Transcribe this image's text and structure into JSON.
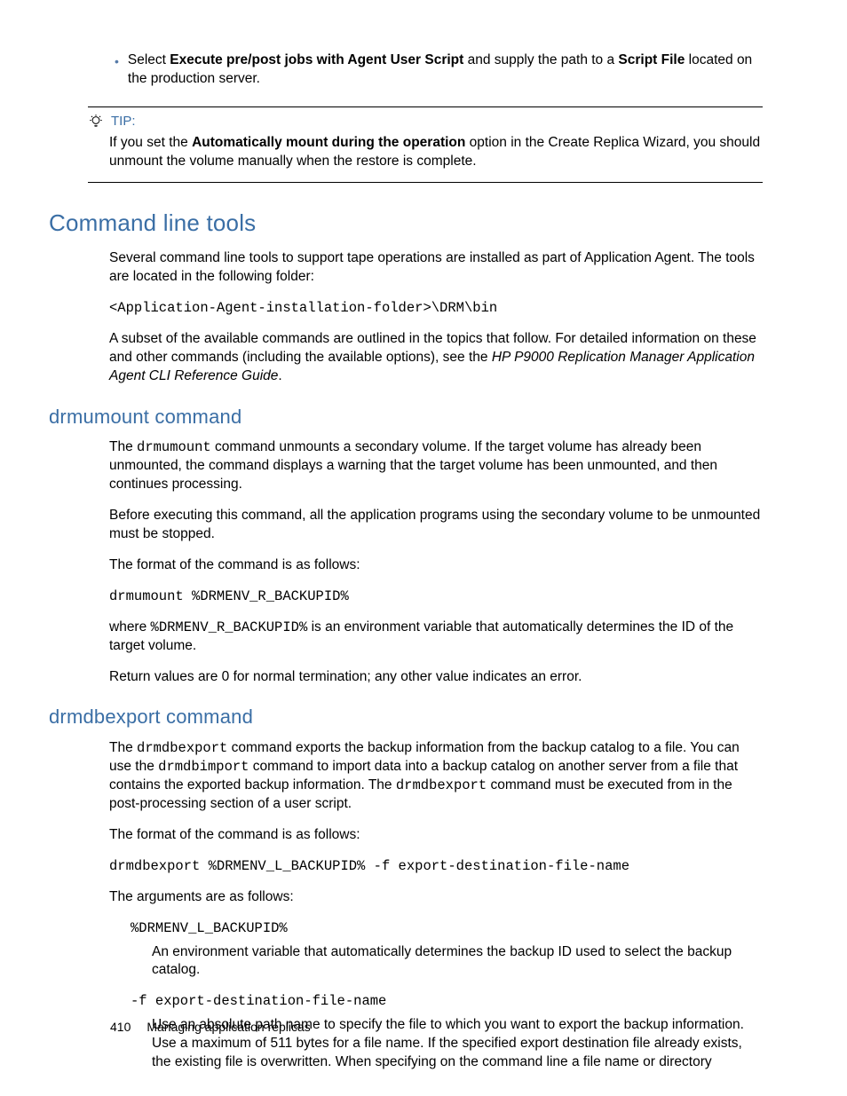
{
  "bullet": {
    "pre": "Select ",
    "b1": "Execute pre/post jobs with Agent User Script",
    "mid": " and supply the path to a ",
    "b2": "Script File",
    "post": " located on the production server."
  },
  "tip": {
    "label": "TIP:",
    "pre": "If you set the ",
    "bold": "Automatically mount during the operation",
    "post": " option in the Create Replica Wizard, you should unmount the volume manually when the restore is complete."
  },
  "s1": {
    "title": "Command line tools",
    "p1": "Several command line tools to support tape operations are installed as part of Application Agent. The tools are located in the following folder:",
    "code": "<Application-Agent-installation-folder>\\DRM\\bin",
    "p2_a": "A subset of the available commands are outlined in the topics that follow. For detailed information on these and other commands (including the available options), see the ",
    "p2_i": "HP P9000 Replication Manager Application Agent CLI Reference Guide",
    "p2_b": "."
  },
  "s2": {
    "title": "drmumount command",
    "p1_a": "The ",
    "p1_cmd": "drmumount",
    "p1_b": " command unmounts a secondary volume. If the target volume has already been unmounted, the command displays a warning that the target volume has been unmounted, and then continues processing.",
    "p2": "Before executing this command, all the application programs using the secondary volume to be unmounted must be stopped.",
    "p3": "The format of the command is as follows:",
    "code": "drmumount %DRMENV_R_BACKUPID%",
    "p4_a": "where ",
    "p4_env": "%DRMENV_R_BACKUPID%",
    "p4_b": " is an environment variable that automatically determines the ID of the target volume.",
    "p5": "Return values are 0 for normal termination; any other value indicates an error."
  },
  "s3": {
    "title": "drmdbexport command",
    "p1_a": "The ",
    "p1_c1": "drmdbexport",
    "p1_b": " command exports the backup information from the backup catalog to a file. You can use the ",
    "p1_c2": "drmdbimport",
    "p1_c": " command to import data into a backup catalog on another server from a file that contains the exported backup information. The ",
    "p1_c3": "drmdbexport",
    "p1_d": " command must be executed from in the post-processing section of a user script.",
    "p2": "The format of the command is as follows:",
    "code": "drmdbexport %DRMENV_L_BACKUPID% -f export-destination-file-name",
    "p3": "The arguments are as follows:",
    "arg1_label": "%DRMENV_L_BACKUPID%",
    "arg1_body": "An environment variable that automatically determines the backup ID used to select the backup catalog.",
    "arg2_label": "-f export-destination-file-name",
    "arg2_body": "Use an absolute path name to specify the file to which you want to export the backup information. Use a maximum of 511 bytes for a file name. If the specified export destination file already exists, the existing file is overwritten. When specifying on the command line a file name or directory"
  },
  "footer": {
    "page": "410",
    "chapter": "Managing application replicas"
  }
}
